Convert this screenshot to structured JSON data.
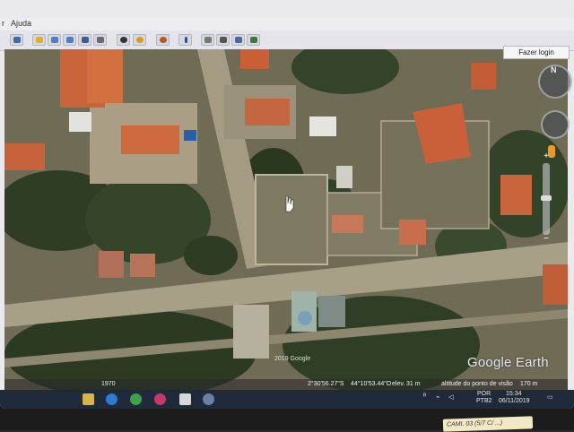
{
  "menu": {
    "help": "Ajuda"
  },
  "toolbar": {
    "buttons": [
      {
        "icon": "sidebar-icon",
        "color": "#3b6bb5"
      },
      {
        "icon": "placemark-icon",
        "color": "#e0b020"
      },
      {
        "icon": "polygon-icon",
        "color": "#4a7fd0"
      },
      {
        "icon": "path-icon",
        "color": "#4a7fd0"
      },
      {
        "icon": "overlay-icon",
        "color": "#3d5d95"
      },
      {
        "icon": "tour-icon",
        "color": "#6b6b6b"
      },
      {
        "icon": "history-icon",
        "color": "#333333"
      },
      {
        "icon": "sun-icon",
        "color": "#d99a20"
      },
      {
        "icon": "planet-icon",
        "color": "#c2541e"
      },
      {
        "icon": "ruler-icon",
        "color": "#2d4f9a"
      },
      {
        "icon": "email-icon",
        "color": "#777777"
      },
      {
        "icon": "print-icon",
        "color": "#555555"
      },
      {
        "icon": "save-image-icon",
        "color": "#4466aa"
      },
      {
        "icon": "maps-icon",
        "color": "#3a7a3a"
      }
    ],
    "login_label": "Fazer login"
  },
  "map": {
    "watermark": "Google Earth",
    "copyright": "2019 Google",
    "year": "1970",
    "status": {
      "coords_lat": "2°30'56.27\"S",
      "coords_lon": "44°10'53.44\"O",
      "elev": "elev.",
      "elev_value": "31 m",
      "eye_alt": "altitude do ponto de visão",
      "eye_alt_value": "170 m"
    }
  },
  "taskbar": {
    "lang": "POR",
    "layout": "PTB2",
    "time": "15:34",
    "date": "06/11/2019"
  },
  "sticker": "CAMI. 03 (5/7 C/ ...)"
}
